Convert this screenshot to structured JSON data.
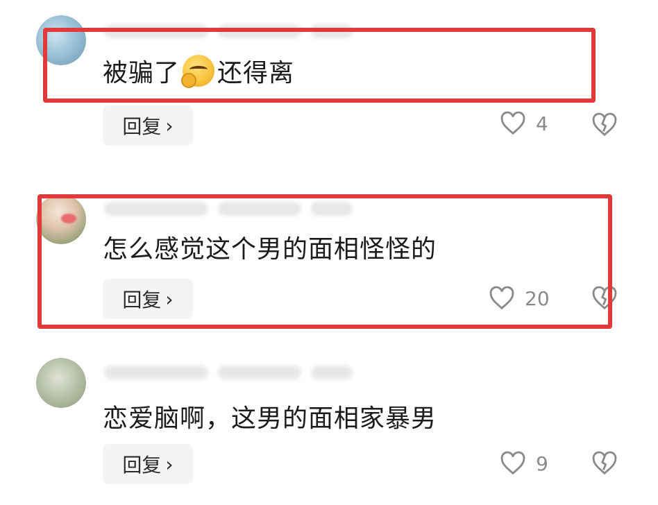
{
  "comments": [
    {
      "text_before": "被骗了",
      "emoji": "smirk-emoji",
      "text_after": "还得离",
      "reply_label": "回复",
      "likes": "4"
    },
    {
      "text": "怎么感觉这个男的面相怪怪的",
      "reply_label": "回复",
      "likes": "20"
    },
    {
      "text": "恋爱脑啊，这男的面相家暴男",
      "reply_label": "回复",
      "likes": "9"
    }
  ],
  "colors": {
    "highlight": "#e03a3a",
    "reply_bg": "#f4f4f4",
    "icon_gray": "#8a8a8a"
  },
  "icons": {
    "reply_chevron": "chevron-right-icon",
    "like": "heart-outline-icon",
    "dislike": "broken-heart-icon"
  }
}
